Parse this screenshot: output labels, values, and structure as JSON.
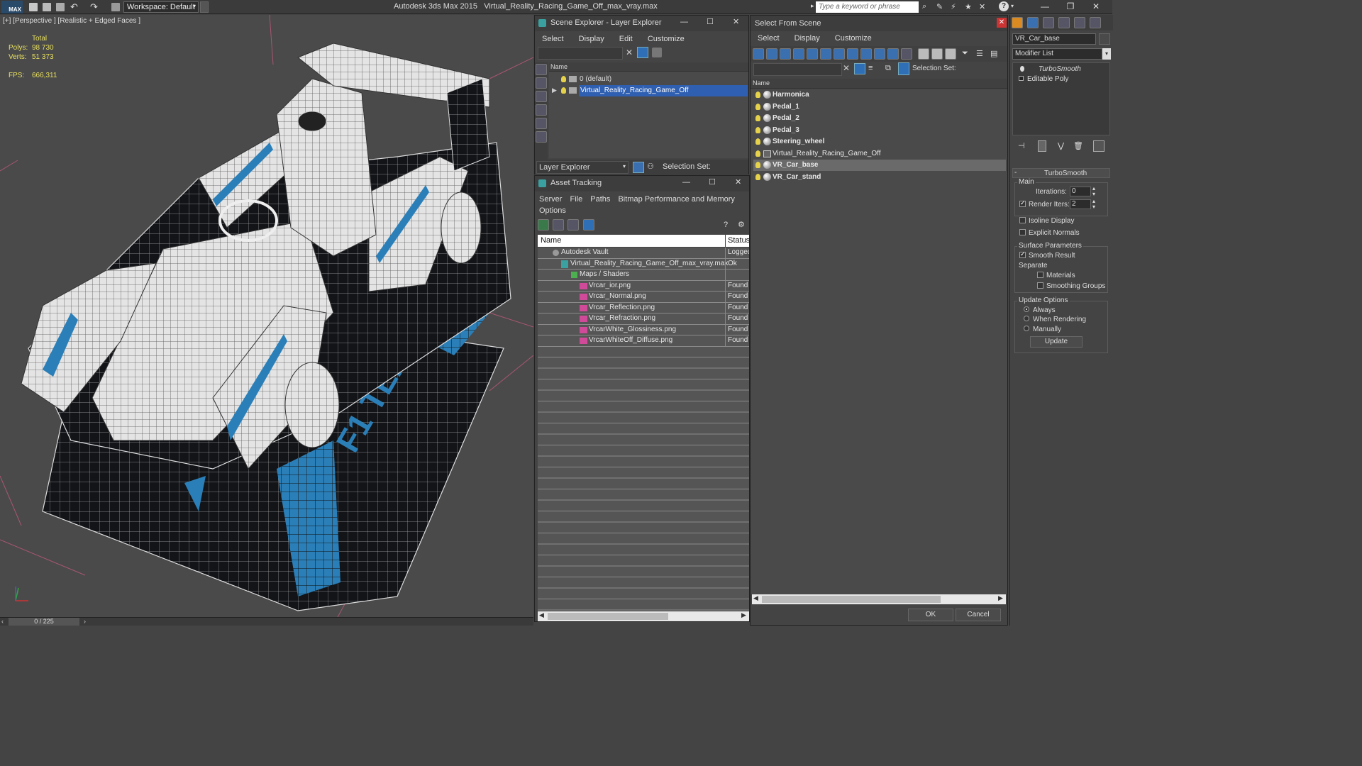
{
  "titlebar": {
    "logo": "MAX",
    "workspace": "Workspace: Default",
    "app": "Autodesk 3ds Max  2015",
    "file": "Virtual_Reality_Racing_Game_Off_max_vray.max",
    "search_placeholder": "Type a keyword or phrase"
  },
  "viewport": {
    "label": "[+] [Perspective ] [Realistic + Edged Faces ]",
    "stats": {
      "total_label": "Total",
      "polys_label": "Polys:",
      "polys": "98 730",
      "verts_label": "Verts:",
      "verts": "51 373",
      "fps_label": "FPS:",
      "fps": "666,311"
    },
    "timeline": "0 / 225"
  },
  "scene_explorer": {
    "title": "Scene Explorer - Layer Explorer",
    "menu": [
      "Select",
      "Display",
      "Edit",
      "Customize"
    ],
    "column_name": "Name",
    "layers": [
      "0 (default)",
      "Virtual_Reality_Racing_Game_Off"
    ],
    "footer_label": "Layer Explorer",
    "selection_set": "Selection Set:"
  },
  "asset_tracking": {
    "title": "Asset Tracking",
    "menu": [
      "Server",
      "File",
      "Paths",
      "Bitmap Performance and Memory",
      "Options"
    ],
    "col_name": "Name",
    "col_status": "Status",
    "rows": [
      {
        "name": "Autodesk Vault",
        "status": "Logged"
      },
      {
        "name": "Virtual_Reality_Racing_Game_Off_max_vray.max",
        "status": "Ok"
      },
      {
        "name": "Maps / Shaders",
        "status": ""
      },
      {
        "name": "Vrcar_ior.png",
        "status": "Found"
      },
      {
        "name": "Vrcar_Normal.png",
        "status": "Found"
      },
      {
        "name": "Vrcar_Reflection.png",
        "status": "Found"
      },
      {
        "name": "Vrcar_Refraction.png",
        "status": "Found"
      },
      {
        "name": "VrcarWhite_Glossiness.png",
        "status": "Found"
      },
      {
        "name": "VrcarWhiteOff_Diffuse.png",
        "status": "Found"
      }
    ]
  },
  "select_from_scene": {
    "title": "Select From Scene",
    "menu": [
      "Select",
      "Display",
      "Customize"
    ],
    "selection_set": "Selection Set:",
    "column_name": "Name",
    "objects": [
      "Harmonica",
      "Pedal_1",
      "Pedal_2",
      "Pedal_3",
      "Steering_wheel",
      "Virtual_Reality_Racing_Game_Off",
      "VR_Car_base",
      "VR_Car_stand"
    ],
    "ok": "OK",
    "cancel": "Cancel"
  },
  "command_panel": {
    "object_name": "VR_Car_base",
    "modifier_list": "Modifier List",
    "stack": [
      "TurboSmooth",
      "Editable Poly"
    ],
    "rollout": "TurboSmooth",
    "main_label": "Main",
    "iterations_label": "Iterations:",
    "iterations": "0",
    "render_iters_label": "Render Iters:",
    "render_iters": "2",
    "isoline": "Isoline Display",
    "explicit_normals": "Explicit Normals",
    "surface_params": "Surface Parameters",
    "smooth_result": "Smooth Result",
    "separate": "Separate",
    "materials": "Materials",
    "smoothing_groups": "Smoothing Groups",
    "update_options": "Update Options",
    "always": "Always",
    "when_rendering": "When Rendering",
    "manually": "Manually",
    "update": "Update"
  }
}
